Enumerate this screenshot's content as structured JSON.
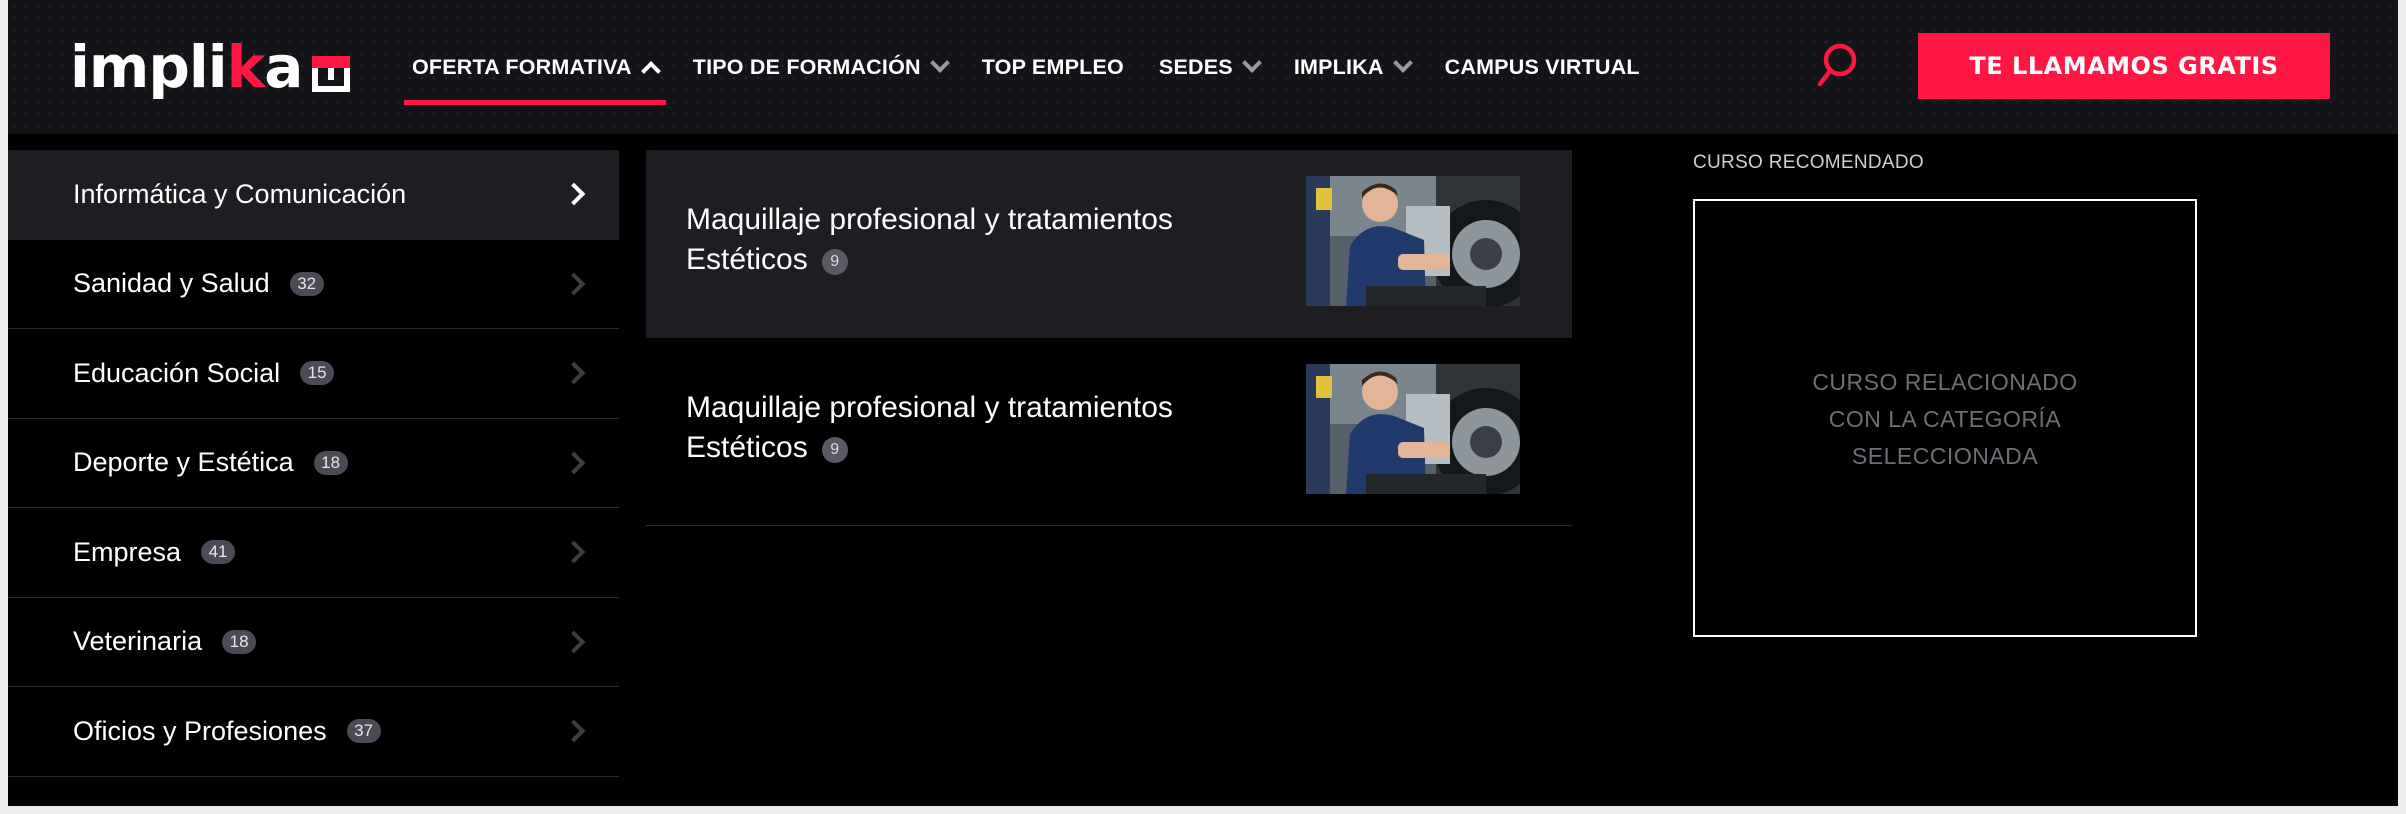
{
  "header": {
    "logo": {
      "text_pre": "impli",
      "text_accent": "k",
      "text_post": "a"
    },
    "nav": [
      {
        "label": "OFERTA FORMATIVA",
        "dropdown": true,
        "active": true
      },
      {
        "label": "TIPO DE FORMACIÓN",
        "dropdown": true,
        "active": false
      },
      {
        "label": "TOP EMPLEO",
        "dropdown": false,
        "active": false
      },
      {
        "label": "SEDES",
        "dropdown": true,
        "active": false
      },
      {
        "label": "IMPLIKA",
        "dropdown": true,
        "active": false
      },
      {
        "label": "CAMPUS VIRTUAL",
        "dropdown": false,
        "active": false
      }
    ],
    "search_icon": "search-icon",
    "cta_label": "TE LLAMAMOS GRATIS"
  },
  "categories": [
    {
      "label": "Informática y Comunicación",
      "count": "",
      "selected": true
    },
    {
      "label": "Sanidad y Salud",
      "count": "32",
      "selected": false
    },
    {
      "label": "Educación Social",
      "count": "15",
      "selected": false
    },
    {
      "label": "Deporte y Estética",
      "count": "18",
      "selected": false
    },
    {
      "label": "Empresa",
      "count": "41",
      "selected": false
    },
    {
      "label": "Veterinaria",
      "count": "18",
      "selected": false
    },
    {
      "label": "Oficios y Profesiones",
      "count": "37",
      "selected": false
    }
  ],
  "courses": [
    {
      "title": "Maquillaje profesional y tratamientos Estéticos",
      "count": "9",
      "selected": true
    },
    {
      "title": "Maquillaje profesional y tratamientos Estéticos",
      "count": "9",
      "selected": false
    }
  ],
  "recommended": {
    "label": "CURSO RECOMENDADO",
    "placeholder_lines": [
      "CURSO RELACIONADO",
      "CON LA CATEGORÍA",
      "SELECCIONADA"
    ]
  },
  "colors": {
    "accent": "#ff1744",
    "header_bg": "#141418",
    "panel_bg": "#000000",
    "selected_bg": "#1d1d22"
  }
}
